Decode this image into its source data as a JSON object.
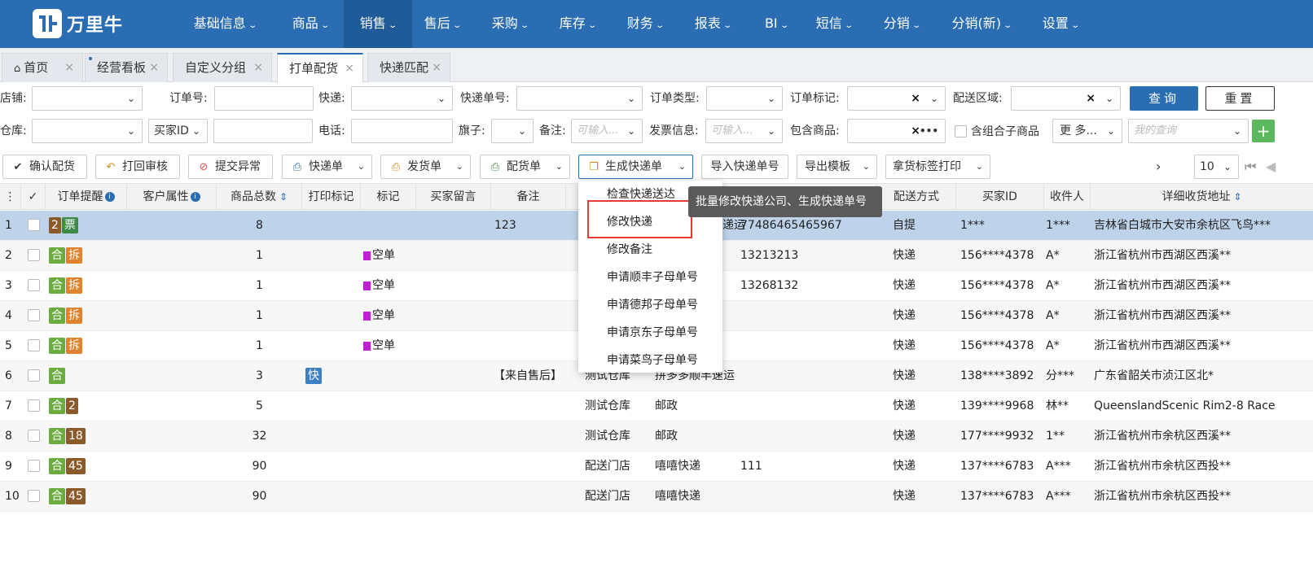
{
  "brand": {
    "name": "万里牛"
  },
  "nav": [
    "基础信息",
    "商品",
    "销售",
    "售后",
    "采购",
    "库存",
    "财务",
    "报表",
    "BI",
    "短信",
    "分销",
    "分销(新)",
    "设置"
  ],
  "tabs": [
    "首页",
    "经营看板",
    "自定义分组",
    "打单配货",
    "快递匹配"
  ],
  "filters": {
    "shop": "店铺:",
    "order_no": "订单号:",
    "express": "快递:",
    "express_no": "快递单号:",
    "order_type": "订单类型:",
    "order_mark": "订单标记:",
    "delivery_area": "配送区域:",
    "warehouse": "仓库:",
    "buyer_id_select": "买家ID",
    "phone": "电话:",
    "flag": "旗子:",
    "remark": "备注:",
    "remark_placeholder": "可输入...",
    "invoice": "发票信息:",
    "invoice_placeholder": "可输入...",
    "contains_goods": "包含商品:",
    "combo_label": "含组合子商品",
    "more": "更 多...",
    "my_query_placeholder": "我的查询",
    "query_btn": "查询",
    "reset_btn": "重置",
    "plus": "+"
  },
  "toolbar": {
    "confirm": "确认配货",
    "back_review": "打回审核",
    "submit_abnormal": "提交异常",
    "express_sheet": "快递单",
    "ship_sheet": "发货单",
    "pick_sheet": "配货单",
    "gen_express": "生成快递单",
    "import_express": "导入快递单号",
    "export_tpl": "导出模板",
    "label_print": "拿货标签打印",
    "next": "›",
    "page_size": "10",
    "first_page": "⏮"
  },
  "dropdown": {
    "items": [
      "检查快递送达",
      "修改快递",
      "修改备注",
      "申请顺丰子母单号",
      "申请德邦子母单号",
      "申请京东子母单号",
      "申请菜鸟子母单号"
    ],
    "tooltip": "批量修改快递公司、生成快递单号"
  },
  "table": {
    "headers": {
      "menu": "⋮",
      "check": "✓",
      "remind": "订单提醒",
      "cust_attr": "客户属性",
      "qty": "商品总数",
      "print_mark": "打印标记",
      "mark": "标记",
      "buyer_msg": "买家留言",
      "remark": "备注",
      "ship_method": "配送方式",
      "buyer_id": "买家ID",
      "receiver": "收件人",
      "address": "详细收货地址"
    },
    "rows": [
      {
        "n": "1",
        "badges": [
          [
            "2",
            "num"
          ],
          [
            "票",
            "piao"
          ]
        ],
        "qty": "8",
        "print": "",
        "mark": "",
        "remark": "123",
        "wh": "",
        "exp": "递运",
        "expno": "77486465465967",
        "ship": "自提",
        "bid": "1***",
        "recv": "1***",
        "addr": "吉林省白城市大安市余杭区飞鸟***"
      },
      {
        "n": "2",
        "badges": [
          [
            "合",
            "he"
          ],
          [
            "拆",
            "chai"
          ]
        ],
        "qty": "1",
        "print": "",
        "mark": "空单",
        "remark": "",
        "wh": "",
        "exp": "",
        "expno": "13213213",
        "ship": "快递",
        "bid": "156****4378",
        "recv": "A*",
        "addr": "浙江省杭州市西湖区西溪**"
      },
      {
        "n": "3",
        "badges": [
          [
            "合",
            "he"
          ],
          [
            "拆",
            "chai"
          ]
        ],
        "qty": "1",
        "print": "",
        "mark": "空单",
        "remark": "",
        "wh": "",
        "exp": "",
        "expno": "13268132",
        "ship": "快递",
        "bid": "156****4378",
        "recv": "A*",
        "addr": "浙江省杭州市西湖区西溪**"
      },
      {
        "n": "4",
        "badges": [
          [
            "合",
            "he"
          ],
          [
            "拆",
            "chai"
          ]
        ],
        "qty": "1",
        "print": "",
        "mark": "空单",
        "remark": "",
        "wh": "",
        "exp": "",
        "expno": "",
        "ship": "快递",
        "bid": "156****4378",
        "recv": "A*",
        "addr": "浙江省杭州市西湖区西溪**"
      },
      {
        "n": "5",
        "badges": [
          [
            "合",
            "he"
          ],
          [
            "拆",
            "chai"
          ]
        ],
        "qty": "1",
        "print": "",
        "mark": "空单",
        "remark": "",
        "wh": "",
        "exp": "",
        "expno": "",
        "ship": "快递",
        "bid": "156****4378",
        "recv": "A*",
        "addr": "浙江省杭州市西湖区西溪**"
      },
      {
        "n": "6",
        "badges": [
          [
            "合",
            "he"
          ]
        ],
        "qty": "3",
        "print": "快",
        "mark": "",
        "remark": "【来自售后】",
        "wh": "测试仓库",
        "exp": "拼多多顺丰速运",
        "expno": "",
        "ship": "快递",
        "bid": "138****3892",
        "recv": "分***",
        "addr": "广东省韶关市浈江区北*"
      },
      {
        "n": "7",
        "badges": [
          [
            "合",
            "he"
          ],
          [
            "2",
            "num"
          ]
        ],
        "qty": "5",
        "print": "",
        "mark": "",
        "remark": "",
        "wh": "测试仓库",
        "exp": "邮政",
        "expno": "",
        "ship": "快递",
        "bid": "139****9968",
        "recv": "林**",
        "addr": "QueenslandScenic Rim2-8 Race"
      },
      {
        "n": "8",
        "badges": [
          [
            "合",
            "he"
          ],
          [
            "18",
            "num"
          ]
        ],
        "qty": "32",
        "print": "",
        "mark": "",
        "remark": "",
        "wh": "测试仓库",
        "exp": "邮政",
        "expno": "",
        "ship": "快递",
        "bid": "177****9932",
        "recv": "1**",
        "addr": "浙江省杭州市余杭区西溪**"
      },
      {
        "n": "9",
        "badges": [
          [
            "合",
            "he"
          ],
          [
            "45",
            "num"
          ]
        ],
        "qty": "90",
        "print": "",
        "mark": "",
        "remark": "",
        "wh": "配送门店",
        "exp": "嘻嘻快递",
        "expno": "111",
        "ship": "快递",
        "bid": "137****6783",
        "recv": "A***",
        "addr": "浙江省杭州市余杭区西投**"
      },
      {
        "n": "10",
        "badges": [
          [
            "合",
            "he"
          ],
          [
            "45",
            "num"
          ]
        ],
        "qty": "90",
        "print": "",
        "mark": "",
        "remark": "",
        "wh": "配送门店",
        "exp": "嘻嘻快递",
        "expno": "",
        "ship": "快递",
        "bid": "137****6783",
        "recv": "A***",
        "addr": "浙江省杭州市余杭区西投**"
      }
    ]
  },
  "colors": {
    "nav_bg": "#2a6db3",
    "selected_row": "#bed3ea",
    "highlight": "#e53935"
  }
}
